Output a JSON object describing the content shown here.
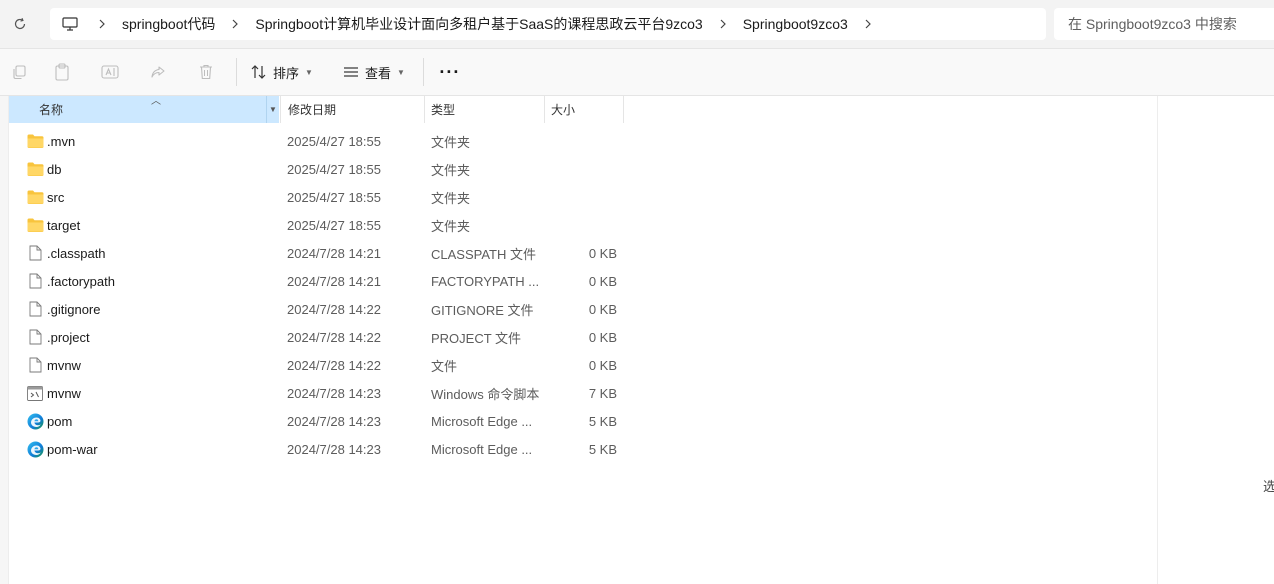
{
  "address": {
    "breadcrumb": [
      "springboot代码",
      "Springboot计算机毕业设计面向多租户基于SaaS的课程思政云平台9zco3",
      "Springboot9zco3"
    ],
    "search_placeholder": "在 Springboot9zco3 中搜索"
  },
  "toolbar": {
    "sort_label": "排序",
    "view_label": "查看",
    "more_label": "···"
  },
  "columns": {
    "name": "名称",
    "date": "修改日期",
    "type": "类型",
    "size": "大小"
  },
  "files": [
    {
      "name": ".mvn",
      "date": "2025/4/27 18:55",
      "type": "文件夹",
      "size": "",
      "icon": "folder-icon"
    },
    {
      "name": "db",
      "date": "2025/4/27 18:55",
      "type": "文件夹",
      "size": "",
      "icon": "folder-icon"
    },
    {
      "name": "src",
      "date": "2025/4/27 18:55",
      "type": "文件夹",
      "size": "",
      "icon": "folder-icon"
    },
    {
      "name": "target",
      "date": "2025/4/27 18:55",
      "type": "文件夹",
      "size": "",
      "icon": "folder-icon"
    },
    {
      "name": ".classpath",
      "date": "2024/7/28 14:21",
      "type": "CLASSPATH 文件",
      "size": "0 KB",
      "icon": "file-icon"
    },
    {
      "name": ".factorypath",
      "date": "2024/7/28 14:21",
      "type": "FACTORYPATH ...",
      "size": "0 KB",
      "icon": "file-icon"
    },
    {
      "name": ".gitignore",
      "date": "2024/7/28 14:22",
      "type": "GITIGNORE 文件",
      "size": "0 KB",
      "icon": "file-icon"
    },
    {
      "name": ".project",
      "date": "2024/7/28 14:22",
      "type": "PROJECT 文件",
      "size": "0 KB",
      "icon": "file-icon"
    },
    {
      "name": "mvnw",
      "date": "2024/7/28 14:22",
      "type": "文件",
      "size": "0 KB",
      "icon": "file-icon"
    },
    {
      "name": "mvnw",
      "date": "2024/7/28 14:23",
      "type": "Windows 命令脚本",
      "size": "7 KB",
      "icon": "script-icon"
    },
    {
      "name": "pom",
      "date": "2024/7/28 14:23",
      "type": "Microsoft Edge ...",
      "size": "5 KB",
      "icon": "edge-icon"
    },
    {
      "name": "pom-war",
      "date": "2024/7/28 14:23",
      "type": "Microsoft Edge ...",
      "size": "5 KB",
      "icon": "edge-icon"
    }
  ],
  "preview_text": "选"
}
